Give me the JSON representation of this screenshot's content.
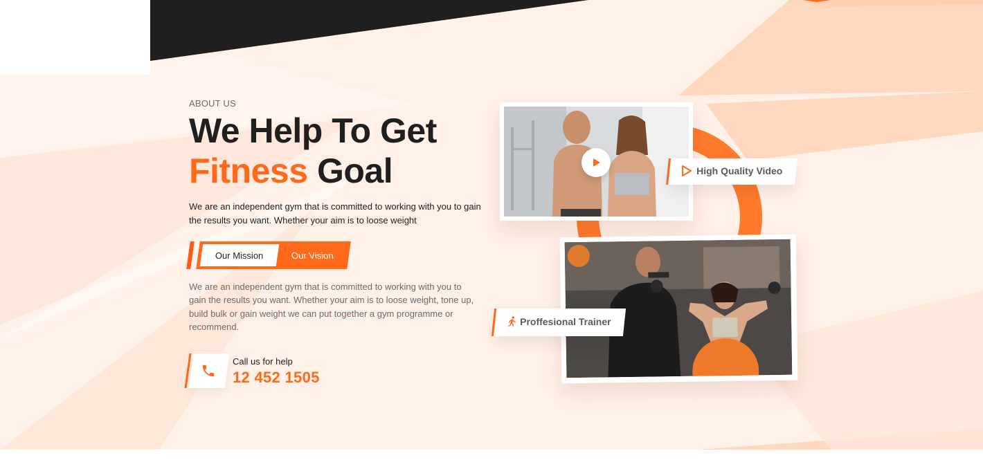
{
  "colors": {
    "accent": "#ff6a1a",
    "dark": "#1f1f1f",
    "peach_light": "#fff0e8",
    "peach_mid": "#ffd9c2"
  },
  "about": {
    "eyebrow": "ABOUT US",
    "headline_line1": "We Help To Get",
    "headline_accent": "Fitness",
    "headline_rest": "Goal",
    "lead": "We are an independent gym that is committed to working with you to gain the results you want. Whether your aim is to loose weight",
    "tabs": [
      {
        "label": "Our Mission",
        "active": true
      },
      {
        "label": "Our Vision",
        "active": false
      }
    ],
    "description": "We are an independent gym that is committed to working with you to gain the results you want. Whether your aim is to loose weight, tone up, build bulk or gain weight we can put together a gym programme or recommend."
  },
  "contact": {
    "icon": "phone-icon",
    "label": "Call us for help",
    "number": "12 452 1505"
  },
  "media": {
    "video_badge": {
      "icon": "play-outline-icon",
      "label": "High Quality Video"
    },
    "trainer_badge": {
      "icon": "runner-icon",
      "label": "Proffesional Trainer"
    },
    "play_icon": "play-icon"
  }
}
